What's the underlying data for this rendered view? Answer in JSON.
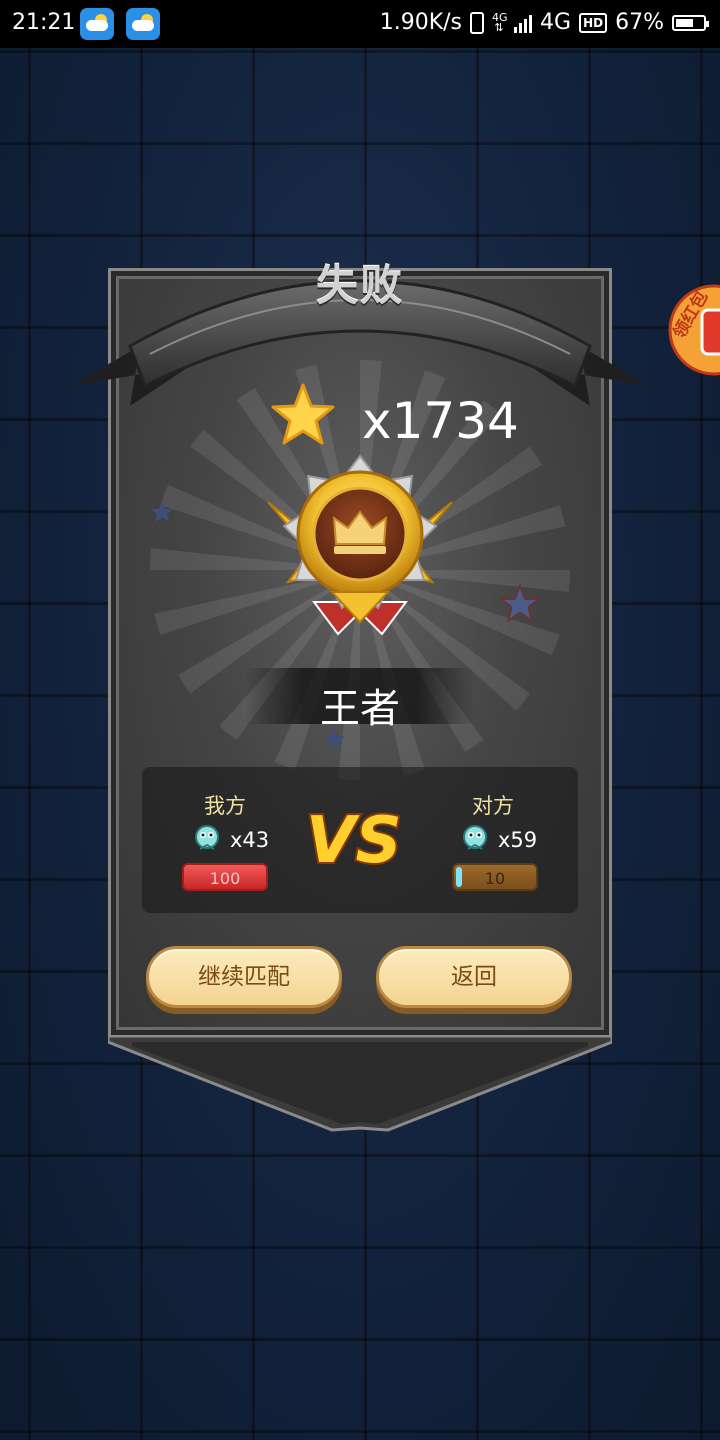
{
  "statusbar": {
    "time": "21:21",
    "net_speed": "1.90K/s",
    "network_small": "4G",
    "network": "4G",
    "hd": "HD",
    "battery": "67%",
    "battery_level": 0.67,
    "icons": [
      "weather-icon",
      "weather-icon",
      "vibrate-icon",
      "data-arrows-icon",
      "signal-icon",
      "battery-icon"
    ]
  },
  "result": {
    "title": "失败",
    "star_count": "x1734",
    "rank": "王者"
  },
  "versus": {
    "my_side": {
      "label": "我方",
      "pet_count": "x43",
      "score": "100"
    },
    "opponent": {
      "label": "对方",
      "pet_count": "x59",
      "score": "10"
    },
    "vs_label": "VS"
  },
  "buttons": {
    "continue_label": "继续匹配",
    "back_label": "返回"
  },
  "side_badge": {
    "text": "领红包"
  },
  "colors": {
    "accent_gold": "#f3d492",
    "bar_red": "#e03c3c",
    "bar_brown": "#8a5c25",
    "background": "#13233d"
  }
}
